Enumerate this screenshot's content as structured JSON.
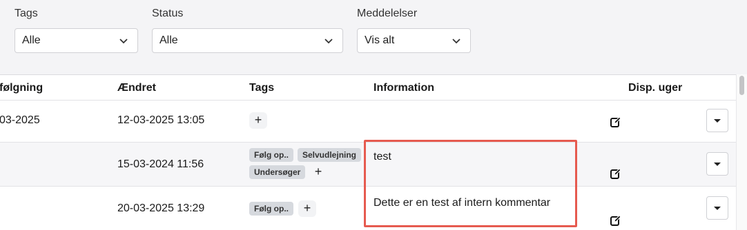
{
  "filters": {
    "tags": {
      "label": "Tags",
      "value": "Alle"
    },
    "status": {
      "label": "Status",
      "value": "Alle"
    },
    "messages": {
      "label": "Meddelelser",
      "value": "Vis alt"
    }
  },
  "table": {
    "columns": {
      "followup": "følgning",
      "changed": "Ændret",
      "tags": "Tags",
      "information": "Information",
      "weeks": "Disp. uger"
    },
    "rows": [
      {
        "followup": "03-2025",
        "changed": "12-03-2025 13:05",
        "tags": [],
        "add_tag": "+",
        "information": ""
      },
      {
        "followup": "",
        "changed": "15-03-2024 11:56",
        "tags": [
          "Følg op..",
          "Selvudlejning",
          "Undersøger"
        ],
        "add_tag": "+",
        "information": "test"
      },
      {
        "followup": "",
        "changed": "20-03-2025 13:29",
        "tags": [
          "Følg op.."
        ],
        "add_tag": "+",
        "information": "Dette er en test af intern kommentar"
      }
    ]
  },
  "icons": {
    "chevron": "chevron-down-icon",
    "edit": "edit-icon",
    "dropdown": "caret-down-icon"
  },
  "colors": {
    "highlight": "#e65a4f",
    "tag_bg": "#d6d9de",
    "background": "#f4f4f6"
  }
}
